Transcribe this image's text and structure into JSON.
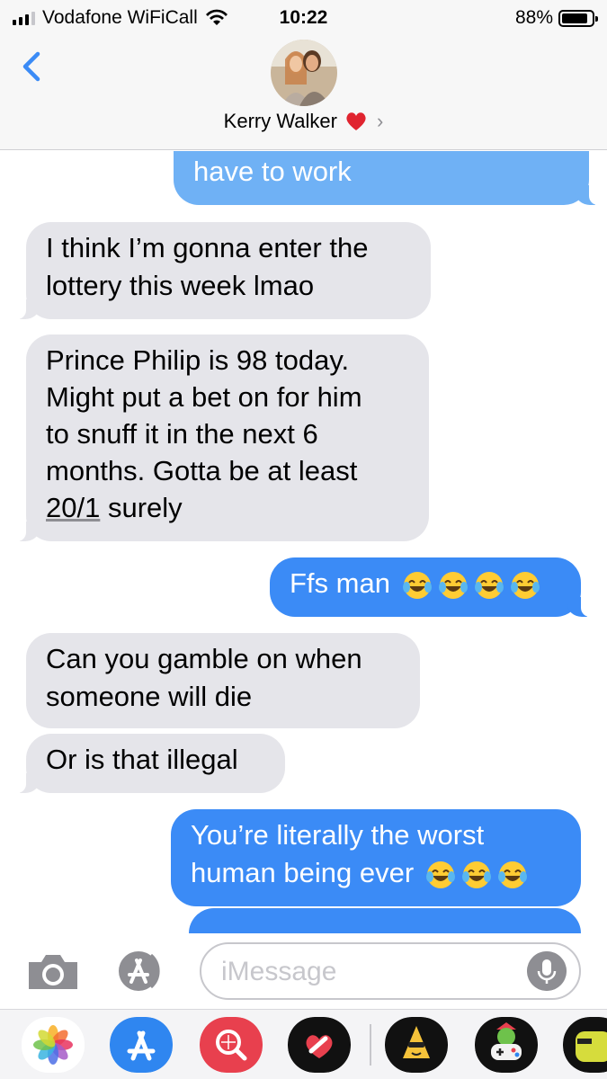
{
  "status_bar": {
    "carrier": "Vodafone WiFiCall",
    "time": "10:22",
    "battery": "88%",
    "battery_level": 0.88
  },
  "header": {
    "contact_name": "Kerry Walker",
    "contact_emoji": "❤️"
  },
  "messages": [
    {
      "side": "out",
      "text": "have to work"
    },
    {
      "side": "in",
      "lines": [
        "I think I’m gonna enter the",
        "lottery this week lmao"
      ]
    },
    {
      "side": "in",
      "lines": [
        "Prince Philip is 98 today.",
        "Might put a bet on for him",
        "to snuff it in the next 6",
        "months. Gotta be at least"
      ],
      "last_line_link": "20/1",
      "last_line_rest": " surely"
    },
    {
      "side": "out",
      "text": "Ffs man"
    },
    {
      "side": "in",
      "lines": [
        "Can you gamble on when",
        "someone will die"
      ]
    },
    {
      "side": "in",
      "text": "Or is that illegal"
    },
    {
      "side": "out",
      "lines": [
        "You’re literally the worst",
        "human being ever"
      ]
    }
  ],
  "input": {
    "placeholder": "iMessage"
  },
  "colors": {
    "incoming_bubble": "#e5e5ea",
    "outgoing_bubble": "#3b8bf6",
    "accent": "#3b8bf6"
  },
  "icons": {
    "back": "chevron-left-icon",
    "camera": "camera-icon",
    "app_store": "app-store-icon",
    "mic": "microphone-icon",
    "emoji": "face-with-tears-of-joy-icon"
  },
  "app_drawer": [
    "photos-app-icon",
    "app-store-app-icon",
    "search-images-app-icon",
    "digital-touch-app-icon",
    "sticker-app-icon",
    "game-app-icon",
    "sticker-pack-app-icon"
  ]
}
